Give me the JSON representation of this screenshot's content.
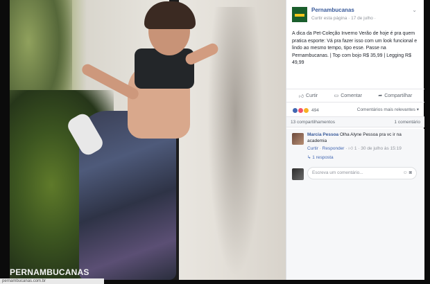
{
  "photo": {
    "watermark": "PERNAMBUCANAS"
  },
  "url_strip": "pernambucanas.com.br",
  "post": {
    "page_name": "Pernambucanas",
    "meta": "Curtir esta página · 17 de julho · ",
    "caption": "A dica da Pet-Coleção Inverno Verão de hoje é pra quem pratica esporte: Vá pra fazer isso com um look funcional e lindo ao mesmo tempo, tipo esse. Passe na Pernambucanas. | Top com bojo R$ 35,99 | Legging R$ 49,99",
    "actions": {
      "like": "Curtir",
      "comment": "Comentar",
      "share": "Compartilhar"
    },
    "reaction_count": "494",
    "sort_label": "Comentários mais relevantes ▾",
    "shares": "13 compartilhamentos",
    "comment_count": "1 comentário",
    "comments": [
      {
        "author": "Marcia Pessoa",
        "text": "Olha Alyne Pessoa pra vc ir na academia",
        "like": "Curtir",
        "reply": "Responder",
        "likes": "1",
        "time": "30 de julho às 15:19"
      }
    ],
    "replies": "1 resposta",
    "compose_placeholder": "Escreva um comentário..."
  }
}
